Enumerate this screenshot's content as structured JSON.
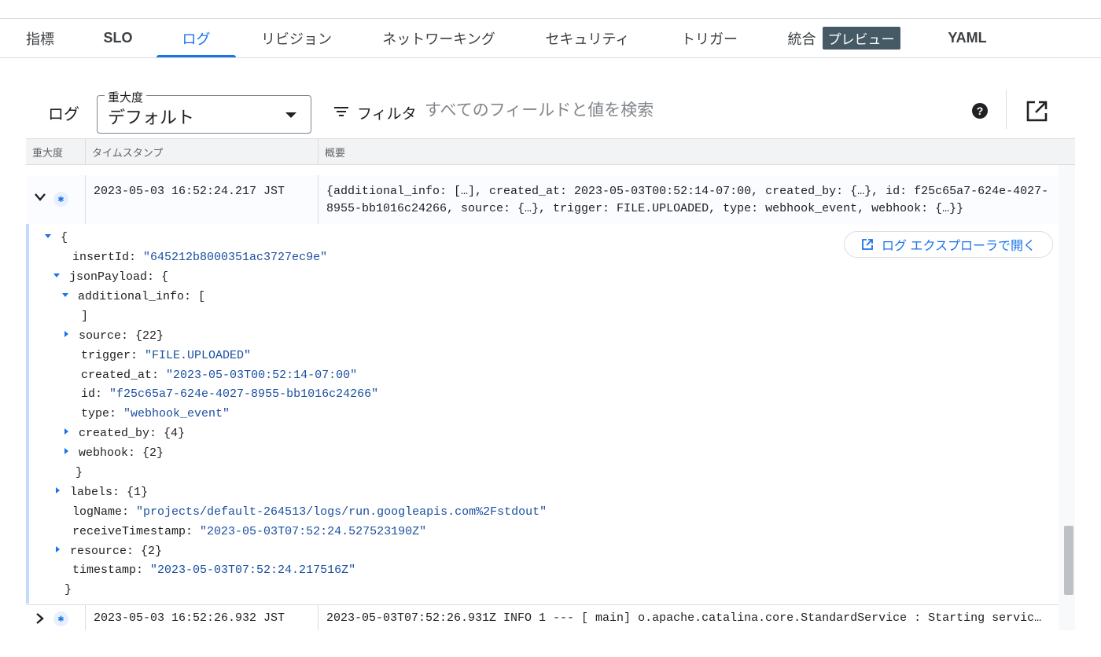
{
  "tabs": [
    {
      "label": "指標"
    },
    {
      "label": "SLO"
    },
    {
      "label": "ログ"
    },
    {
      "label": "リビジョン"
    },
    {
      "label": "ネットワーキング"
    },
    {
      "label": "セキュリティ"
    },
    {
      "label": "トリガー"
    },
    {
      "label": "統合",
      "badge": "プレビュー"
    },
    {
      "label": "YAML"
    }
  ],
  "active_tab": "ログ",
  "toolbar": {
    "title": "ログ",
    "severity_label": "重大度",
    "severity_value": "デフォルト",
    "filter_label": "フィルタ",
    "search_placeholder": "すべてのフィールドと値を検索",
    "help_icon": "?"
  },
  "table": {
    "headers": [
      "重大度",
      "タイムスタンプ",
      "概要"
    ]
  },
  "entries": [
    {
      "timestamp": "2023-05-03 16:52:24.217 JST",
      "summary": "{additional_info: […], created_at: 2023-05-03T00:52:14-07:00, created_by: {…}, id: f25c65a7-624e-4027-8955-bb1016c24266, source: {…}, trigger: FILE.UPLOADED, type: webhook_event, webhook: {…}}",
      "expanded": true
    },
    {
      "timestamp": "2023-05-03 16:52:26.932 JST",
      "summary": "2023-05-03T07:52:26.931Z INFO 1 --- [ main] o.apache.catalina.core.StandardService : Starting servic…",
      "expanded": false
    }
  ],
  "payload": {
    "open_brace": "{",
    "close_brace": "}",
    "open_explorer_label": "ログ エクスプローラで開く",
    "insertId_key": "insertId:",
    "insertId_val": "\"645212b8000351ac3727ec9e\"",
    "jsonPayload_key": "jsonPayload: {",
    "additional_info_key": "additional_info: [",
    "additional_info_close": "]",
    "source_key": "source: {22}",
    "trigger_key": "trigger:",
    "trigger_val": "\"FILE.UPLOADED\"",
    "created_at_key": "created_at:",
    "created_at_val": "\"2023-05-03T00:52:14-07:00\"",
    "id_key": "id:",
    "id_val": "\"f25c65a7-624e-4027-8955-bb1016c24266\"",
    "type_key": "type:",
    "type_val": "\"webhook_event\"",
    "created_by_key": "created_by: {4}",
    "webhook_key": "webhook: {2}",
    "jsonPayload_close": "}",
    "labels_key": "labels: {1}",
    "logName_key": "logName:",
    "logName_val": "\"projects/default-264513/logs/run.googleapis.com%2Fstdout\"",
    "receiveTimestamp_key": "receiveTimestamp:",
    "receiveTimestamp_val": "\"2023-05-03T07:52:24.527523190Z\"",
    "resource_key": "resource: {2}",
    "timestamp_key": "timestamp:",
    "timestamp_val": "\"2023-05-03T07:52:24.217516Z\""
  },
  "colors": {
    "accent": "#1a73e8",
    "string_value": "#1a4fa0",
    "badge_bg": "#455a64"
  }
}
